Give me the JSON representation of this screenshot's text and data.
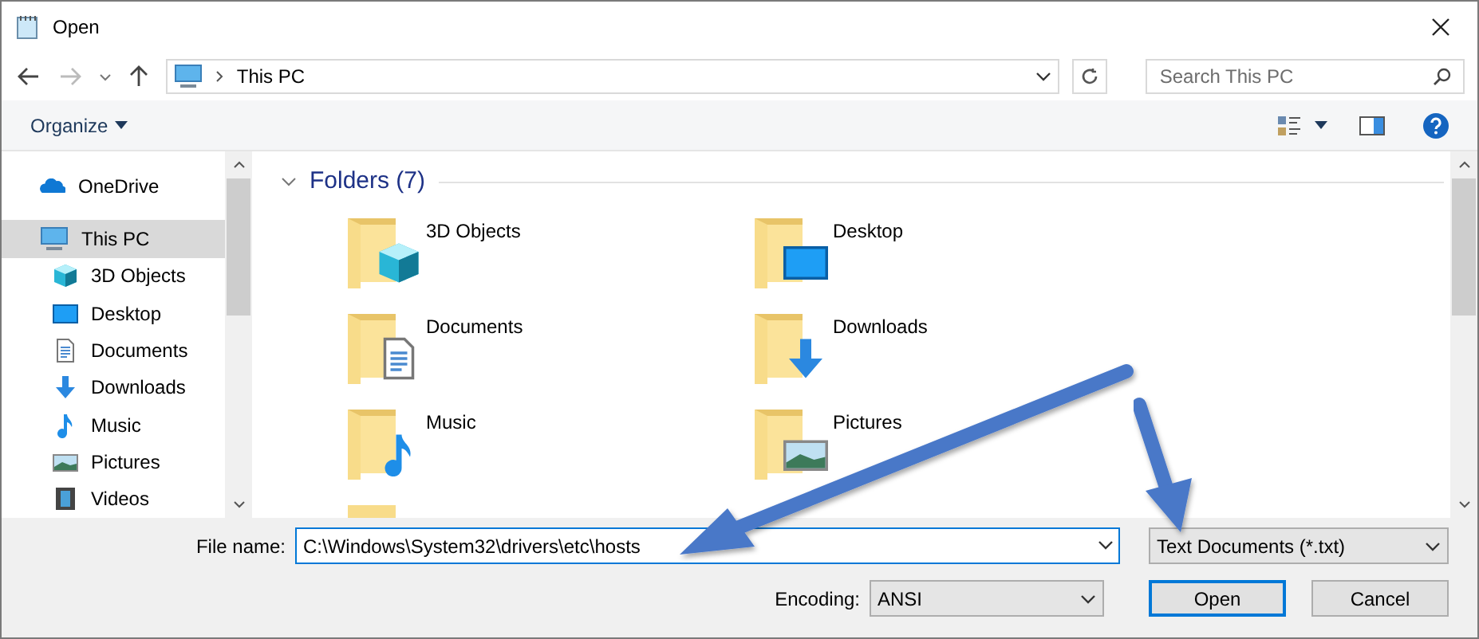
{
  "window": {
    "title": "Open"
  },
  "address": {
    "location": "This PC"
  },
  "search": {
    "placeholder": "Search This PC"
  },
  "toolbar": {
    "organize": "Organize"
  },
  "sidebar": {
    "items": [
      {
        "label": "OneDrive",
        "kind": "cloud",
        "selected": false
      },
      {
        "label": "This PC",
        "kind": "pc",
        "selected": true,
        "children": [
          {
            "label": "3D Objects",
            "kind": "cube",
            "selected": false
          },
          {
            "label": "Desktop",
            "kind": "desktop",
            "selected": false
          },
          {
            "label": "Documents",
            "kind": "documents",
            "selected": false
          },
          {
            "label": "Downloads",
            "kind": "downloads",
            "selected": false
          },
          {
            "label": "Music",
            "kind": "music",
            "selected": false
          },
          {
            "label": "Pictures",
            "kind": "pictures",
            "selected": false
          },
          {
            "label": "Videos",
            "kind": "videos",
            "selected": false
          }
        ]
      }
    ]
  },
  "folders": {
    "heading": "Folders (7)",
    "items": [
      {
        "label": "3D Objects",
        "kind": "cube"
      },
      {
        "label": "Desktop",
        "kind": "desktop"
      },
      {
        "label": "Documents",
        "kind": "documents"
      },
      {
        "label": "Downloads",
        "kind": "downloads"
      },
      {
        "label": "Music",
        "kind": "music"
      },
      {
        "label": "Pictures",
        "kind": "pictures"
      }
    ]
  },
  "file_name": {
    "label": "File name:",
    "value": "C:\\Windows\\System32\\drivers\\etc\\hosts"
  },
  "file_type": {
    "value": "Text Documents (*.txt)"
  },
  "encoding": {
    "label": "Encoding:",
    "value": "ANSI"
  },
  "buttons": [
    {
      "label": "Open",
      "kind": "primary"
    },
    {
      "label": "Cancel",
      "kind": "secondary"
    }
  ]
}
